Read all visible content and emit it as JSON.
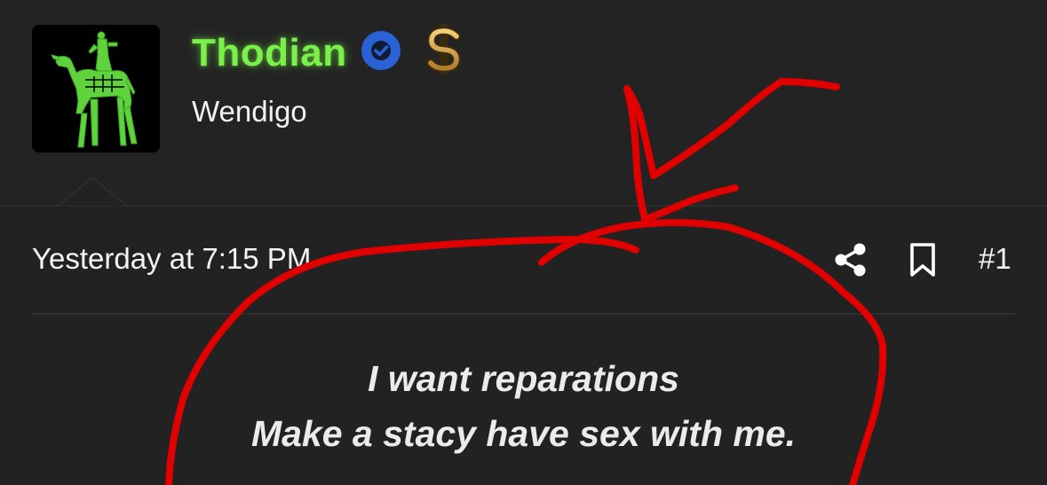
{
  "post": {
    "author": {
      "username": "Thodian",
      "user_title": "Wendigo",
      "badges": [
        "check-badge-icon",
        "dollar-sign-icon"
      ]
    },
    "timestamp": "Yesterday at 7:15 PM",
    "post_number": "#1",
    "actions": [
      "share-icon",
      "bookmark-icon"
    ],
    "body_lines": [
      "I want reparations",
      "Make a stacy have sex with me."
    ]
  },
  "colors": {
    "background": "#222223",
    "username": "#7af04a",
    "verified": "#2a62d6",
    "dollar": "#d9a94a",
    "annotation": "#e00000"
  }
}
